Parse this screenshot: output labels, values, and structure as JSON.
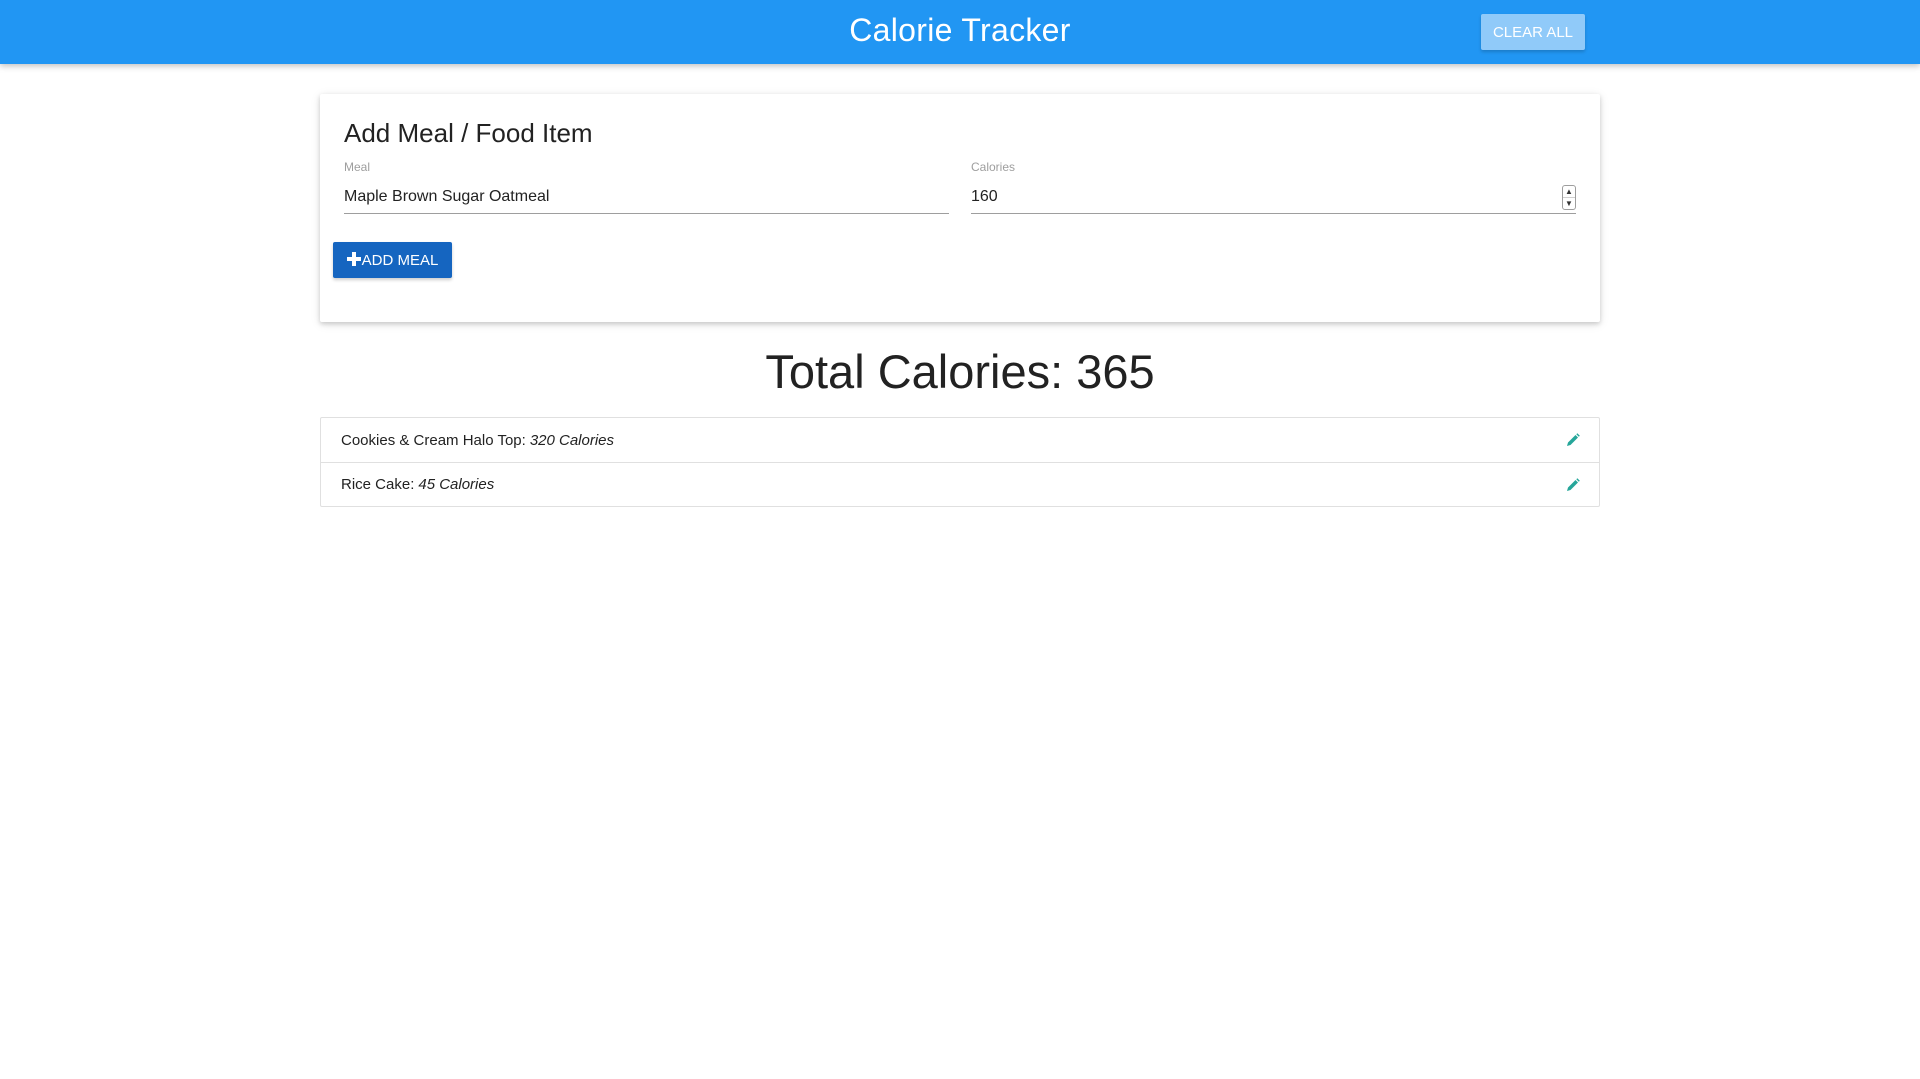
{
  "header": {
    "title": "Calorie Tracker",
    "clear_label": "Clear All"
  },
  "form": {
    "heading": "Add Meal / Food Item",
    "meal_label": "Meal",
    "meal_value": "Maple Brown Sugar Oatmeal",
    "calories_label": "Calories",
    "calories_value": "160",
    "add_label": "Add Meal"
  },
  "total": {
    "text": "Total Calories: 365"
  },
  "meals": [
    {
      "name": "Cookies & Cream Halo Top:",
      "calories": "320 Calories"
    },
    {
      "name": "Rice Cake:",
      "calories": "45 Calories"
    }
  ],
  "icons": {
    "add": "plus-icon",
    "edit": "pencil-icon"
  },
  "colors": {
    "navbar": "#2196f3",
    "clear_button": "#90caf9",
    "add_button": "#1565c0",
    "edit_icon": "#26a69a"
  }
}
